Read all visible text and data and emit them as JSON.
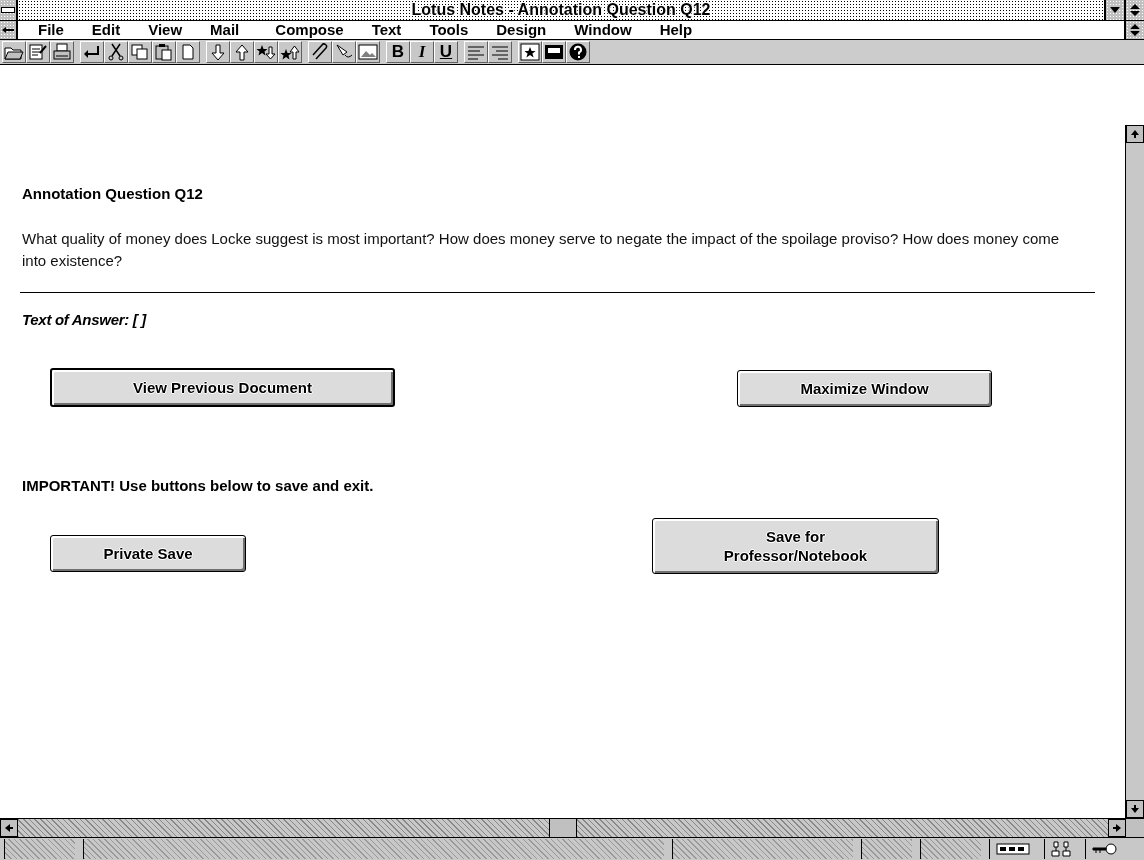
{
  "window": {
    "title": "Lotus Notes - Annotation Question Q12"
  },
  "menu": [
    {
      "label": "File"
    },
    {
      "label": "Edit"
    },
    {
      "label": "View"
    },
    {
      "label": "Mail"
    },
    {
      "label": "Compose"
    },
    {
      "label": "Text"
    },
    {
      "label": "Tools"
    },
    {
      "label": "Design"
    },
    {
      "label": "Window"
    },
    {
      "label": "Help"
    }
  ],
  "format_buttons": [
    "B",
    "I",
    "U"
  ],
  "document": {
    "heading": "Annotation Question Q12",
    "question": "What quality of money does Locke suggest is most important? How does money serve to negate the impact of the spoilage proviso? How does money come into existence?",
    "answer_label": "Text of Answer: [   ]",
    "notice": "IMPORTANT! Use buttons below to save and exit.",
    "view_buttons": [
      {
        "label": "View Previous Document",
        "default": true
      },
      {
        "label": "Maximize Window",
        "default": false
      }
    ],
    "save_buttons": [
      {
        "label": "Private Save",
        "default": false
      },
      {
        "label": "Save for Professor/Notebook",
        "default": false
      }
    ]
  }
}
